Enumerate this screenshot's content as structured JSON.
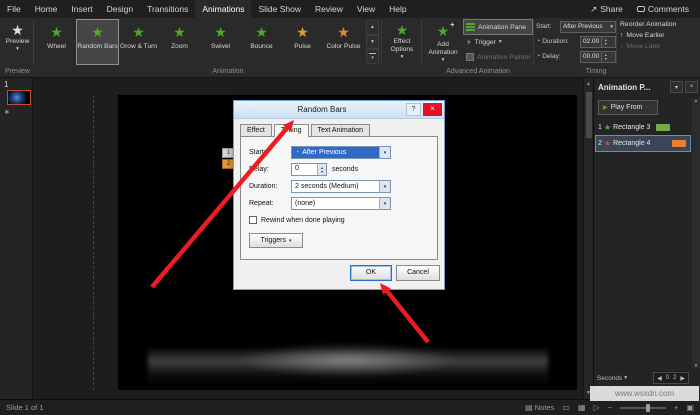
{
  "menu": {
    "items": [
      "File",
      "Home",
      "Insert",
      "Design",
      "Transitions",
      "Animations",
      "Slide Show",
      "Review",
      "View",
      "Help"
    ],
    "active": "Animations",
    "share": "Share",
    "comments": "Comments"
  },
  "ribbon": {
    "preview_label": "Preview",
    "gallery": [
      {
        "label": "Wheel",
        "color": "#4ea72e"
      },
      {
        "label": "Random Bars",
        "color": "#4ea72e"
      },
      {
        "label": "Grow & Turn",
        "color": "#4ea72e"
      },
      {
        "label": "Zoom",
        "color": "#4ea72e"
      },
      {
        "label": "Swivel",
        "color": "#4ea72e"
      },
      {
        "label": "Bounce",
        "color": "#4ea72e"
      },
      {
        "label": "Pulse",
        "color": "#d9a521"
      },
      {
        "label": "Color Pulse",
        "color": "#e08a3c"
      }
    ],
    "selected_animation": "Random Bars",
    "effect_options": "Effect Options",
    "add_animation": "Add Animation",
    "animation_pane": "Animation Pane",
    "trigger": "Trigger",
    "animation_painter": "Animation Painter",
    "start_label": "Start:",
    "start_value": "After Previous",
    "duration_label": "Duration:",
    "duration_value": "02.00",
    "delay_label": "Delay:",
    "delay_value": "00.00",
    "reorder_title": "Reorder Animation",
    "move_earlier": "Move Earlier",
    "move_later": "Move Later",
    "groups": [
      "Preview",
      "Animation",
      "Advanced Animation",
      "Timing"
    ]
  },
  "slide_panel": {
    "number": "1"
  },
  "slide": {
    "anim_tags": [
      "1",
      "2"
    ]
  },
  "dialog": {
    "title": "Random Bars",
    "tabs": [
      "Effect",
      "Timing",
      "Text Animation"
    ],
    "active_tab": "Timing",
    "start_label": "Start:",
    "start_value": "After Previous",
    "delay_label": "Delay:",
    "delay_value": "0",
    "delay_suffix": "seconds",
    "duration_label": "Duration:",
    "duration_value": "2 seconds (Medium)",
    "repeat_label": "Repeat:",
    "repeat_value": "(none)",
    "rewind_label": "Rewind when done playing",
    "triggers_label": "Triggers",
    "ok_label": "OK",
    "cancel_label": "Cancel"
  },
  "pane": {
    "title": "Animation P...",
    "play_from": "Play From",
    "items": [
      {
        "num": "1",
        "name": "Rectangle 3",
        "star_color": "#4ea72e",
        "bar_color": "#70ad47"
      },
      {
        "num": "2",
        "name": "Rectangle 4",
        "star_color": "#d04a35",
        "bar_color": "#ed7d31"
      }
    ],
    "seconds_label": "Seconds",
    "timeline": [
      "0",
      "2"
    ]
  },
  "status": {
    "slide_label": "Slide 1 of 1",
    "notes_label": "Notes"
  },
  "watermark": "www.wsxdn.com",
  "colors": {
    "arrow": "#ed1c24",
    "entrance_star": "#4ea72e",
    "emphasis_star": "#d9a521",
    "selection_orange": "#e89a3c"
  },
  "icons": {
    "star": "★",
    "caret": "▾",
    "up": "▲",
    "down": "▼",
    "spin_up": "▴",
    "spin_down": "▾",
    "play": "▶",
    "close": "×",
    "help": "?",
    "clock": "◔",
    "lightning": "⚡",
    "arrow_up": "↑",
    "arrow_down": "↓",
    "left": "◀",
    "right": "▶",
    "share": "↗",
    "asterisk": "∗",
    "notes": "▤",
    "view_normal": "▭",
    "view_grid": "▦",
    "view_show": "▷",
    "minus": "−",
    "plus": "+",
    "fit": "▣"
  }
}
